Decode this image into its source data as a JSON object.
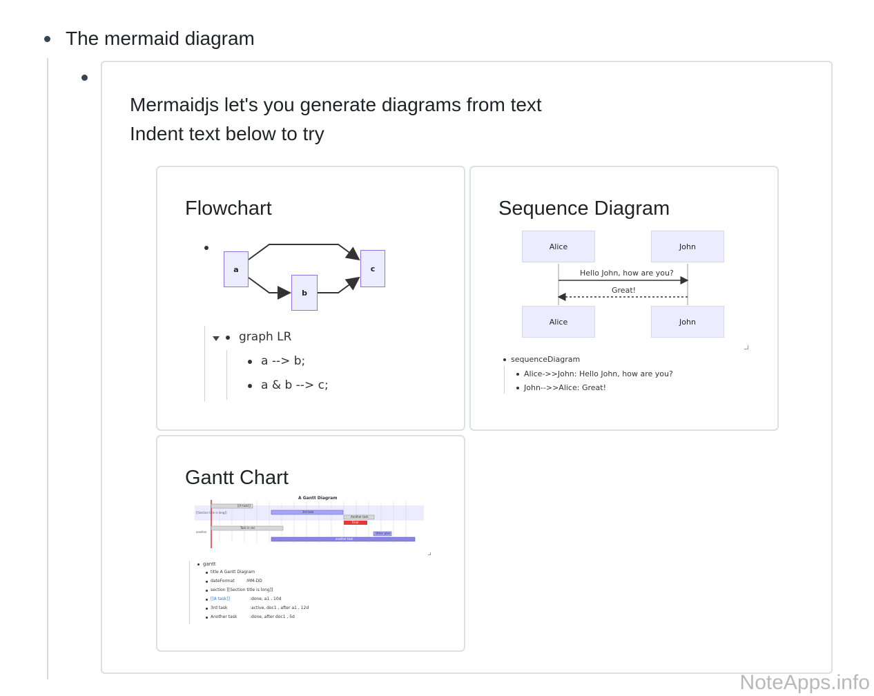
{
  "top_item": {
    "label": "The mermaid diagram"
  },
  "intro": {
    "line1": "Mermaidjs let's you generate diagrams from text",
    "line2": "Indent text below to try"
  },
  "cards": {
    "flowchart": {
      "title": "Flowchart",
      "nodes": [
        "a",
        "b",
        "c"
      ],
      "outline": {
        "root": "graph LR",
        "children": [
          "a --> b;",
          "a & b --> c;"
        ]
      }
    },
    "sequence": {
      "title": "Sequence Diagram",
      "actors": [
        "Alice",
        "John"
      ],
      "messages": [
        "Hello John, how are you?",
        "Great!"
      ],
      "outline": {
        "root": "sequenceDiagram",
        "children": [
          "Alice->>John: Hello John, how are you?",
          "John-->>Alice: Great!"
        ]
      }
    },
    "gantt": {
      "title": "Gantt Chart",
      "chart_title": "A Gantt Diagram",
      "section_labels": [
        "[[Section title is long]]",
        "another"
      ],
      "task_labels": [
        "[[A task]]",
        "3rd task",
        "Another task",
        "Final",
        "Task in sec",
        "Other plan",
        "another task"
      ],
      "outline": {
        "root": "gantt",
        "children": [
          [
            "title A Gantt Diagram",
            ""
          ],
          [
            "dateFormat",
            ":MM-DD"
          ],
          [
            "section [[Section title is long]]",
            ""
          ],
          [
            "[[A task]]",
            ":done, a1 , 10d"
          ],
          [
            "3rd task",
            ":active, doc1 ,   after  a1 , 12d"
          ],
          [
            "Another task",
            ":done,          after doc1 , 5d"
          ]
        ]
      }
    }
  },
  "watermark": "NoteApps.info",
  "colors": {
    "node_fill": "#ECECFF",
    "node_border": "#9370DB",
    "today_line": "#e03030",
    "final_task": "#e53935"
  }
}
